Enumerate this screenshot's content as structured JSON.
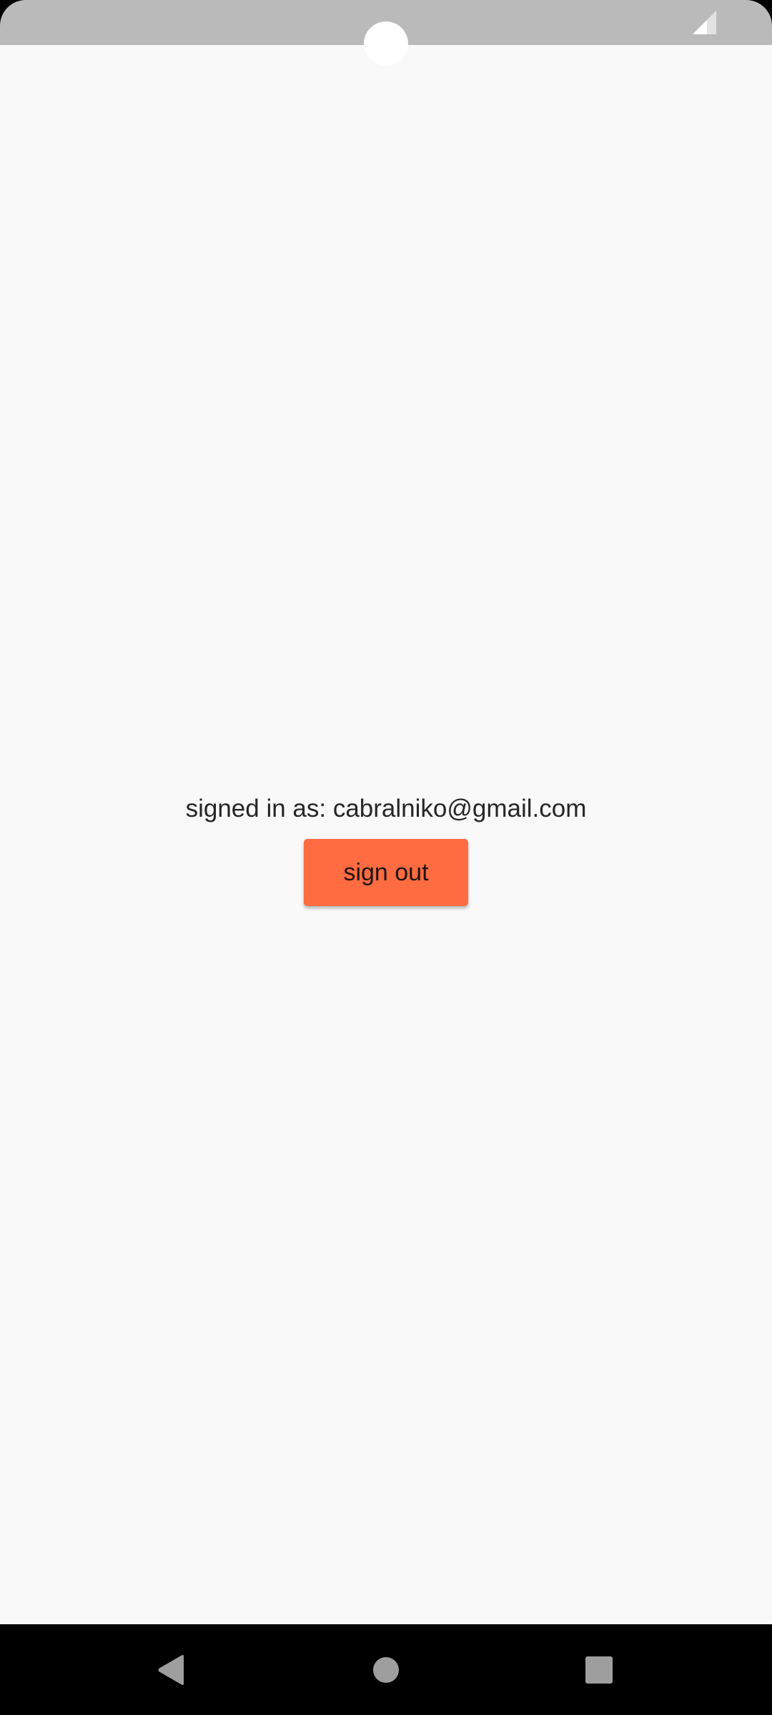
{
  "status_bar": {
    "background": "#bababa",
    "icons": [
      "camera-cutout",
      "signal-icon"
    ]
  },
  "main": {
    "signed_in_text": "signed in as: cabralniko@gmail.com",
    "sign_out_label": "sign out",
    "sign_out_color": "#ff6c42",
    "background": "#f9f9f9"
  },
  "nav_bar": {
    "background": "#000000",
    "icon_color": "#9e9e9e",
    "icons": [
      "back-icon",
      "home-icon",
      "recents-icon"
    ]
  }
}
